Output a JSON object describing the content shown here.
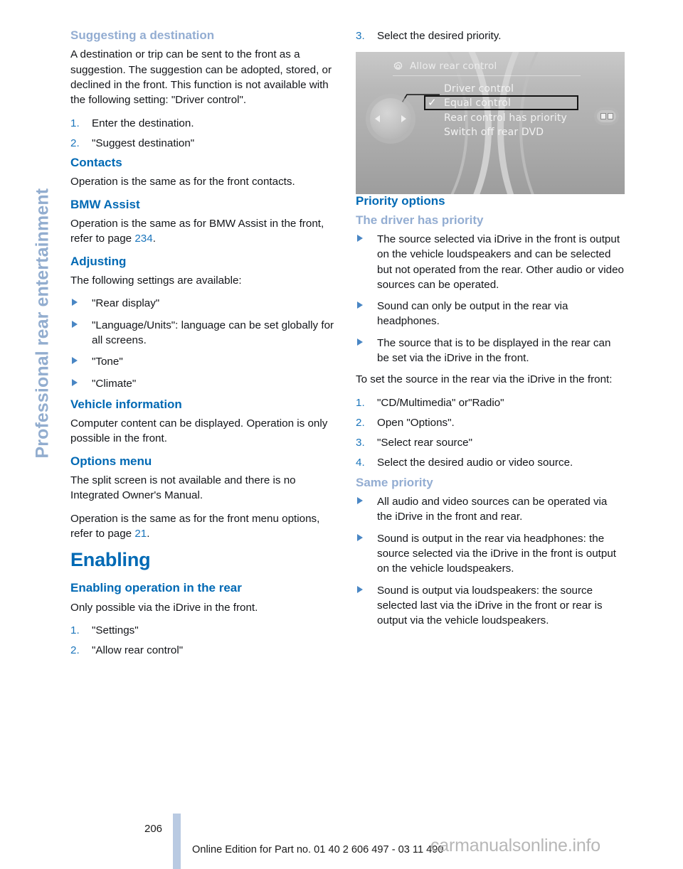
{
  "sidetab": {
    "label": "Professional rear entertainment",
    "color": "#92adcf"
  },
  "colors": {
    "heading_dark_blue": "#0069b4",
    "heading_light_blue": "#93add2",
    "list_number_blue": "#1b75bb",
    "page_ref_blue": "#1b75bb",
    "page_bar": "#b9cae2",
    "body_text": "#14161a"
  },
  "left_column": {
    "suggesting": {
      "heading": "Suggesting a destination",
      "paragraph": "A destination or trip can be sent to the front as a suggestion. The suggestion can be adopted, stored, or declined in the front. This function is not available with the following setting: \"Driver control\".",
      "steps": [
        {
          "num": "1.",
          "text": "Enter the destination."
        },
        {
          "num": "2.",
          "text": "\"Suggest destination\""
        }
      ]
    },
    "contacts": {
      "heading": "Contacts",
      "paragraph": "Operation is the same as for the front contacts."
    },
    "bmw_assist": {
      "heading": "BMW Assist",
      "text_before": "Operation is the same as for BMW Assist in the front, refer to page ",
      "page_ref": "234",
      "text_after": "."
    },
    "adjusting": {
      "heading": "Adjusting",
      "intro": "The following settings are available:",
      "bullets": [
        "\"Rear display\"",
        "\"Language/Units\": language can be set globally for all screens.",
        "\"Tone\"",
        "\"Climate\""
      ]
    },
    "vehicle_information": {
      "heading": "Vehicle information",
      "paragraph": "Computer content can be displayed. Operation is only possible in the front."
    },
    "options_menu": {
      "heading": "Options menu",
      "paragraph1": "The split screen is not available and there is no Integrated Owner's Manual.",
      "paragraph2_before": "Operation is the same as for the front menu options, refer to page ",
      "page_ref": "21",
      "paragraph2_after": "."
    },
    "enabling": {
      "heading": "Enabling",
      "sub_heading": "Enabling operation in the rear",
      "paragraph": "Only possible via the iDrive in the front.",
      "steps": [
        {
          "num": "1.",
          "text": "\"Settings\""
        },
        {
          "num": "2.",
          "text": "\"Allow rear control\""
        }
      ]
    }
  },
  "right_column": {
    "step3": {
      "num": "3.",
      "text": "Select the desired priority."
    },
    "figure": {
      "title": "Allow rear control",
      "icon": "gear-icon",
      "menu_items": [
        "Driver control",
        "Equal control",
        "Rear control has priority",
        "Switch off rear DVD"
      ],
      "selected_index": 1,
      "check_glyph": "✓"
    },
    "priority_options": {
      "heading": "Priority options"
    },
    "driver_priority": {
      "heading": "The driver has priority",
      "bullets": [
        "The source selected via iDrive in the front is output on the vehicle loudspeakers and can be selected but not operated from the rear. Other audio or video sources can be operated.",
        "Sound can only be output in the rear via headphones.",
        "The source that is to be displayed in the rear can be set via the iDrive in the front."
      ],
      "intro": "To set the source in the rear via the iDrive in the front:",
      "steps": [
        {
          "num": "1.",
          "text": "\"CD/Multimedia\" or\"Radio\""
        },
        {
          "num": "2.",
          "text": "Open \"Options\"."
        },
        {
          "num": "3.",
          "text": "\"Select rear source\""
        },
        {
          "num": "4.",
          "text": "Select the desired audio or video source."
        }
      ]
    },
    "same_priority": {
      "heading": "Same priority",
      "bullets": [
        "All audio and video sources can be operated via the iDrive in the front and rear.",
        "Sound is output in the rear via headphones: the source selected via the iDrive in the front is output on the vehicle loudspeakers.",
        "Sound is output via loudspeakers: the source selected last via the iDrive in the front or rear is output via the vehicle loudspeakers."
      ]
    }
  },
  "footer": {
    "page_number": "206",
    "edition_line": "Online Edition for Part no. 01 40 2 606 497 - 03 11 490",
    "watermark": "carmanualsonline.info"
  }
}
